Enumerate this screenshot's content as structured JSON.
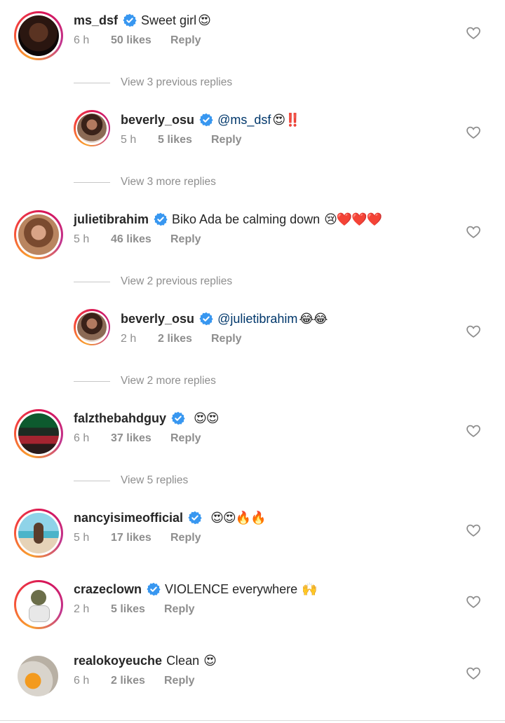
{
  "comments": [
    {
      "username": "ms_dsf",
      "verified": true,
      "text": "Sweet girl",
      "emoji": "😍",
      "time": "6 h",
      "likes": "50 likes",
      "reply": "Reply"
    },
    {
      "username": "beverly_osu",
      "verified": true,
      "mention": "@ms_dsf",
      "emoji": "😍‼️",
      "time": "5 h",
      "likes": "5 likes",
      "reply": "Reply"
    },
    {
      "username": "julietibrahim",
      "verified": true,
      "text": "Biko Ada be calming down",
      "emoji": "😢❤️❤️❤️",
      "time": "5 h",
      "likes": "46 likes",
      "reply": "Reply"
    },
    {
      "username": "beverly_osu",
      "verified": true,
      "mention": "@julietibrahim",
      "emoji": "😂😂",
      "time": "2 h",
      "likes": "2 likes",
      "reply": "Reply"
    },
    {
      "username": "falzthebahdguy",
      "verified": true,
      "text": "",
      "emoji": "😍😍",
      "time": "6 h",
      "likes": "37 likes",
      "reply": "Reply"
    },
    {
      "username": "nancyisimeofficial",
      "verified": true,
      "text": "",
      "emoji": "😍😍🔥🔥",
      "time": "5 h",
      "likes": "17 likes",
      "reply": "Reply"
    },
    {
      "username": "crazeclown",
      "verified": true,
      "text": "VIOLENCE everywhere",
      "emoji": "🙌",
      "time": "2 h",
      "likes": "5 likes",
      "reply": "Reply"
    },
    {
      "username": "realokoyeuche",
      "verified": false,
      "text": "Clean",
      "emoji": "😍",
      "time": "6 h",
      "likes": "2 likes",
      "reply": "Reply"
    }
  ],
  "view_links": [
    "View 3 previous replies",
    "View 3 more replies",
    "View 2 previous replies",
    "View 2 more replies",
    "View 5 replies"
  ],
  "colors": {
    "verified_badge": "#3897f0",
    "muted_text": "#8e8e8e",
    "primary_text": "#262626",
    "mention": "#00376b"
  },
  "icons": {
    "verified": "verified-badge-icon",
    "like": "heart-outline-icon"
  }
}
